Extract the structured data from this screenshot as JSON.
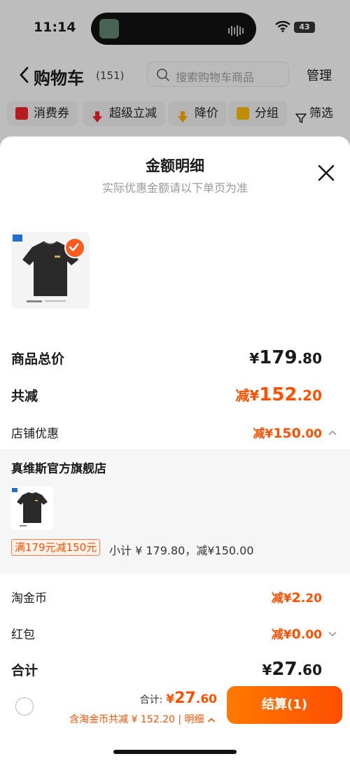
{
  "status_bar": {
    "time": "11:14",
    "battery": "43"
  },
  "cart_header": {
    "title": "购物车",
    "count": "(151)",
    "search_placeholder": "搜索购物车商品",
    "manage": "管理"
  },
  "filters": [
    {
      "label": "消费券",
      "icon": "coupon-icon"
    },
    {
      "label": "超级立减",
      "icon": "down-arrow-icon"
    },
    {
      "label": "降价",
      "icon": "price-drop-icon"
    },
    {
      "label": "分组",
      "icon": "folder-icon"
    },
    {
      "label": "筛选",
      "icon": "filter-icon"
    }
  ],
  "sheet": {
    "title": "金额明细",
    "subtitle": "实际优惠金额请以下单页为准",
    "rows": {
      "goods_total": {
        "label": "商品总价",
        "symbol": "¥",
        "int": "179",
        "dec": ".80"
      },
      "total_reduce": {
        "label": "共减",
        "prefix": "减¥",
        "int": "152",
        "dec": ".20"
      },
      "shop_discount": {
        "label": "店铺优惠",
        "prefix": "减¥",
        "int": "150",
        "dec": ".00"
      },
      "taojinbi": {
        "label": "淘金币",
        "prefix": "减¥",
        "int": "2",
        "dec": ".20"
      },
      "red_packet": {
        "label": "红包",
        "prefix": "减¥",
        "int": "0",
        "dec": ".00"
      },
      "sum": {
        "label": "合计",
        "symbol": "¥",
        "int": "27",
        "dec": ".60"
      }
    },
    "shop": {
      "name": "真维斯官方旗舰店",
      "promo": "满179元减150元",
      "subtotal": "小计 ¥ 179.80，减¥150.00"
    }
  },
  "bottom_bar": {
    "total_label": "合计:",
    "total_symbol": "¥",
    "total_int": "27",
    "total_dec": ".60",
    "discount_note": "含淘金币共减 ¥ 152.20 | 明细",
    "checkout": "结算(1)"
  },
  "colors": {
    "accent": "#ff5000",
    "checkout_start": "#ff7a00",
    "checkout_end": "#ff4e00"
  }
}
